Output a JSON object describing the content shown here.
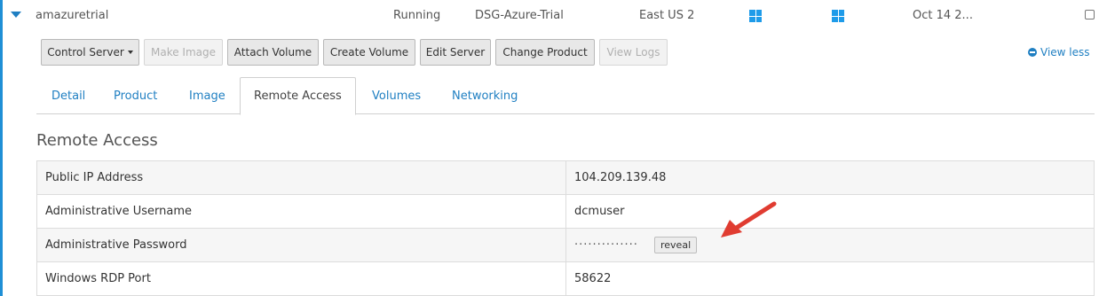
{
  "server": {
    "name": "amazuretrial",
    "status": "Running",
    "project": "DSG-Azure-Trial",
    "region": "East US 2",
    "date": "Oct 14 2..."
  },
  "toolbar": {
    "control_server": "Control Server",
    "make_image": "Make Image",
    "attach_volume": "Attach Volume",
    "create_volume": "Create Volume",
    "edit_server": "Edit Server",
    "change_product": "Change Product",
    "view_logs": "View Logs"
  },
  "view_less": "View less",
  "tabs": [
    "Detail",
    "Product",
    "Image",
    "Remote Access",
    "Volumes",
    "Networking"
  ],
  "active_tab": "Remote Access",
  "section_title": "Remote Access",
  "access_rows": [
    {
      "label": "Public IP Address",
      "value": "104.209.139.48"
    },
    {
      "label": "Administrative Username",
      "value": "dcmuser"
    },
    {
      "label": "Administrative Password",
      "value": "··············",
      "action": "reveal"
    },
    {
      "label": "Windows RDP Port",
      "value": "58622"
    }
  ],
  "colors": {
    "accent": "#1f7fc2",
    "windows_icon": "#1e9be9",
    "annotation_arrow": "#e03c31"
  },
  "icons": {
    "expand": "caret-down-icon",
    "os": "windows-icon",
    "view_less": "minus-circle-icon",
    "annotation": "arrow-icon"
  }
}
